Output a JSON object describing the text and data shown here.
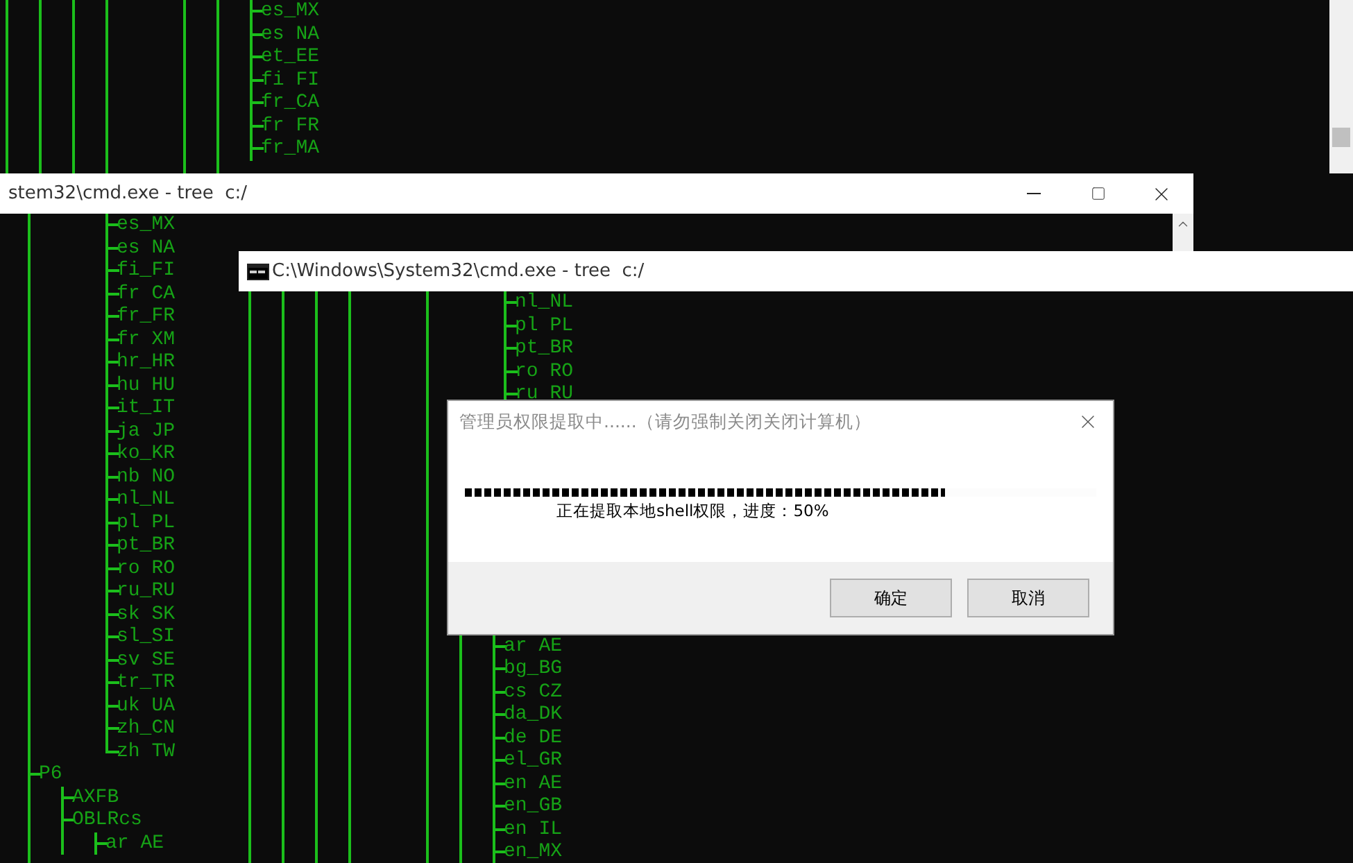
{
  "background_console": {
    "sections": [
      {
        "closed": false,
        "items": [
          {
            "label": "es_MX"
          },
          {
            "label": "es NA"
          },
          {
            "label": "et_EE"
          },
          {
            "label": "fi FI"
          },
          {
            "label": "fr_CA"
          },
          {
            "label": "fr FR"
          },
          {
            "label": "fr_MA"
          }
        ]
      }
    ]
  },
  "middle_console": {
    "title": "stem32\\cmd.exe - tree  c:/",
    "sections": [
      {
        "closed": true,
        "items": [
          {
            "label": "es_MX"
          },
          {
            "label": "es NA"
          },
          {
            "label": "fi_FI"
          },
          {
            "label": "fr CA"
          },
          {
            "label": "fr_FR"
          },
          {
            "label": "fr XM"
          },
          {
            "label": "hr_HR"
          },
          {
            "label": "hu HU"
          },
          {
            "label": "it_IT"
          },
          {
            "label": "ja JP"
          },
          {
            "label": "ko_KR"
          },
          {
            "label": "nb NO"
          },
          {
            "label": "nl_NL"
          },
          {
            "label": "pl PL"
          },
          {
            "label": "pt_BR"
          },
          {
            "label": "ro RO"
          },
          {
            "label": "ru_RU"
          },
          {
            "label": "sk SK"
          },
          {
            "label": "sl_SI"
          },
          {
            "label": "sv SE"
          },
          {
            "label": "tr_TR"
          },
          {
            "label": "uk UA"
          },
          {
            "label": "zh_CN"
          },
          {
            "label": "zh TW"
          }
        ]
      },
      {
        "items": [
          {
            "label": "P6",
            "children": [
              {
                "label": "AXFB"
              },
              {
                "label": "OBLRcs",
                "children": [
                  {
                    "label": "ar AE"
                  }
                ]
              }
            ]
          }
        ]
      }
    ]
  },
  "front_console": {
    "title": "C:\\Windows\\System32\\cmd.exe - tree  c:/",
    "sections": [
      {
        "closed": false,
        "items": [
          {
            "label": "nl_NL"
          },
          {
            "label": "pl PL"
          },
          {
            "label": "pt_BR"
          },
          {
            "label": "ro RO"
          },
          {
            "label": "ru RU"
          }
        ]
      },
      {
        "closed": false,
        "items": [
          {
            "label": "ar AE"
          },
          {
            "label": "bg_BG"
          },
          {
            "label": "cs CZ"
          },
          {
            "label": "da_DK"
          },
          {
            "label": "de DE"
          },
          {
            "label": "el_GR"
          },
          {
            "label": "en AE"
          },
          {
            "label": "en_GB"
          },
          {
            "label": "en IL"
          },
          {
            "label": "en_MX"
          }
        ]
      }
    ]
  },
  "dialog": {
    "title": "管理员权限提取中......（请勿强制关闭关闭计算机）",
    "progress": {
      "level": 0.76
    },
    "message": "正在提取本地shell权限，进度：50%",
    "buttons": [
      {
        "label": "确定"
      },
      {
        "label": "取消"
      }
    ]
  }
}
